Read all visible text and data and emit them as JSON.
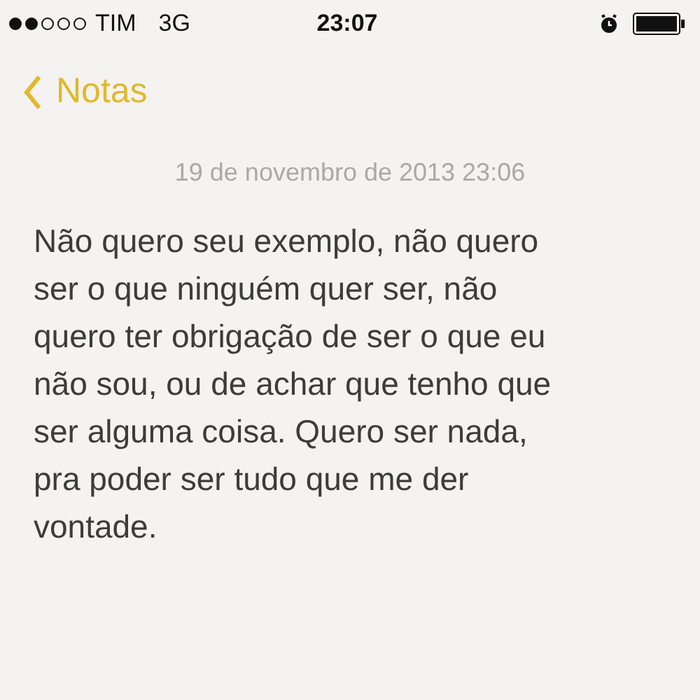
{
  "status_bar": {
    "carrier": "TIM",
    "network": "3G",
    "time": "23:07"
  },
  "nav": {
    "back_label": "Notas"
  },
  "note": {
    "date": "19 de novembro de 2013 23:06",
    "lines": [
      "Não quero seu exemplo, não quero",
      "ser o que ninguém quer ser, não",
      "quero ter obrigação de ser o que eu",
      "não sou, ou de achar que tenho que",
      "ser alguma coisa. Quero ser nada,",
      "pra poder ser tudo que me der",
      "vontade."
    ]
  }
}
